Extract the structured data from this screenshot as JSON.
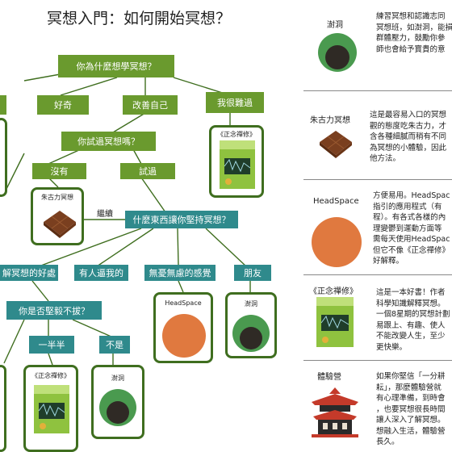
{
  "title": "冥想入門：如何開始冥想？",
  "nodes": {
    "root": "你為什麼想學冥想？",
    "curious": "好奇",
    "improve": "改善自己",
    "stressed": "我很難過",
    "tried": "你試過冥想嗎？",
    "no": "沒有",
    "yes": "試過",
    "continue_label": "繼續",
    "what_keeps": "什麼東西讓你堅持冥想？",
    "benefits": "解冥想的好處",
    "forced": "有人逼我的",
    "worry_free": "無憂無慮的感覺",
    "friends": "朋友",
    "determined": "你是否堅毅不拔？",
    "half": "一半半",
    "no_not": "不是"
  },
  "cards": {
    "book_label": "《正念禪修》",
    "chocolate_label": "朱古力冥想",
    "headspace_label": "HeadSpace",
    "pond_label": "澍洞"
  },
  "sidebar": {
    "items": [
      {
        "label": "澍洞",
        "text": "練習冥想和認識志同\n冥想班，如澍洞，能損\n群體壓力，鼓勵你參\n師也會給予寶貴的意"
      },
      {
        "label": "朱古力冥想",
        "text": "這是最容易入口的冥想\n觀的態度吃朱古力，才\n含各種細膩而稍有不同\n為冥想的小體驗，因此\n他方法。"
      },
      {
        "label": "HeadSpace",
        "text": "方便易用。HeadSpac\n指引的應用程式（有\n程）。有各式各樣的內\n理變鬱到運動方面等\n需每天使用HeadSpac\n但它不像《正念禪修》\n好解釋。"
      },
      {
        "label": "《正念禪修》",
        "text": "這是一本好書！作者\n科學知識解釋冥想。\n一個8星期的冥想計劃\n易跟上、有趣、使人\n不能改變人生，至少\n更快樂。"
      },
      {
        "label": "體驗營",
        "text": "如果你堅信「一分耕\n耘」，那麼體驗營就\n有心理準備，到時會\n，也要冥想很長時間\n讓人深入了解冥想。\n想融入生活，體驗營\n長久。"
      }
    ]
  },
  "colors": {
    "green": "#6a9a2e",
    "teal": "#2f8a8c",
    "dark_green": "#3f6e1f",
    "orange": "#e0793f",
    "chocolate": "#7a3f1f",
    "pagoda": "#c43a2a"
  }
}
